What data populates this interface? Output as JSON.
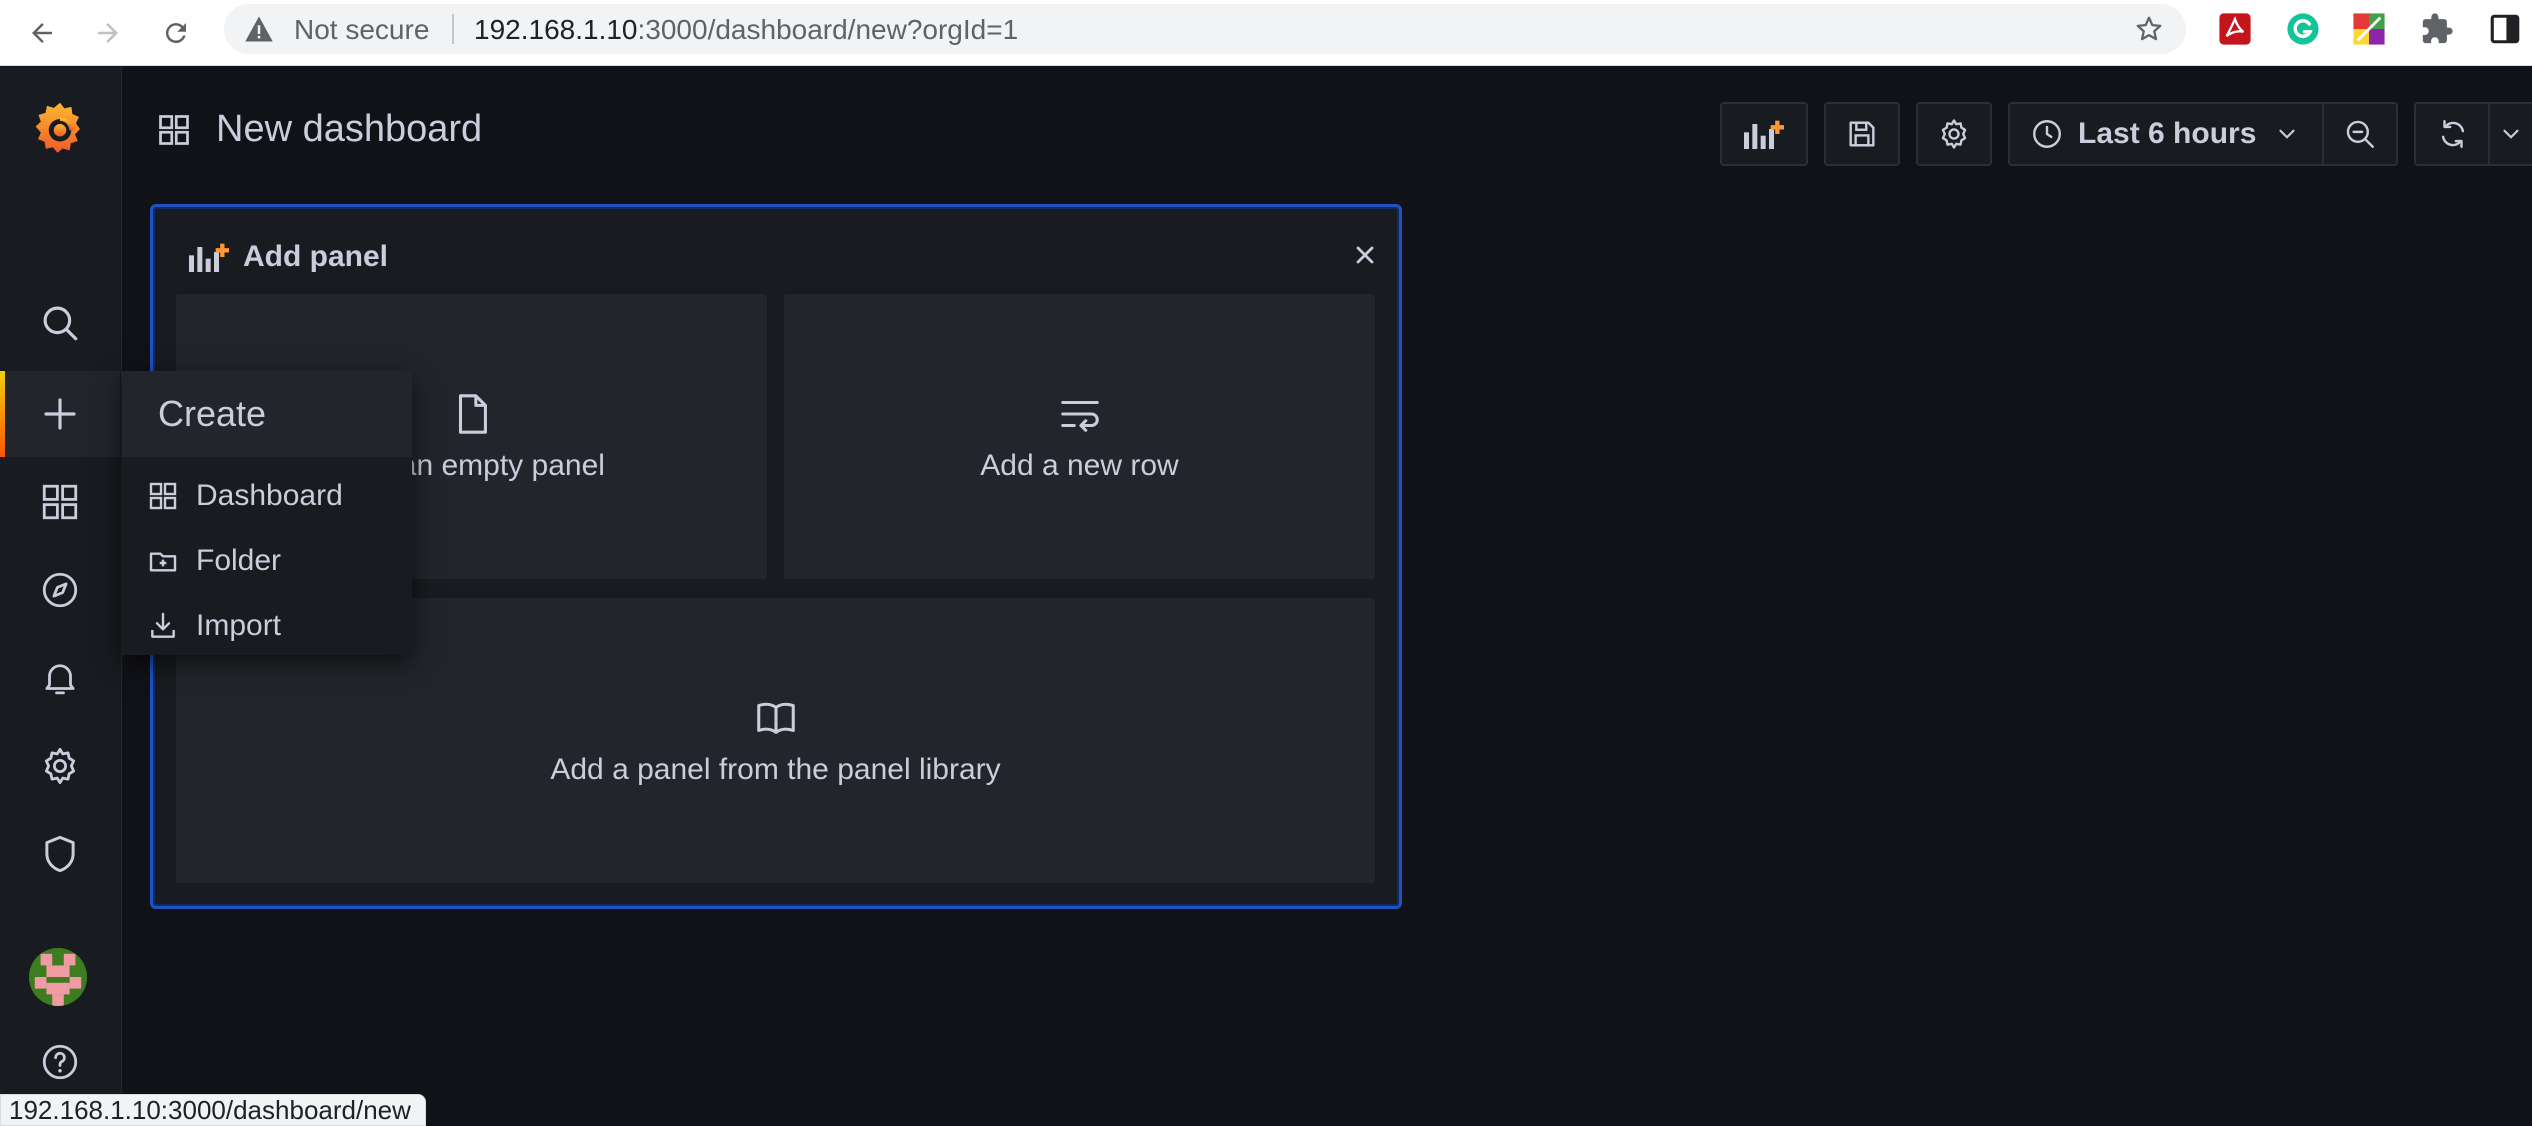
{
  "browser": {
    "security_label": "Not secure",
    "url_host": "192.168.1.10",
    "url_rest": ":3000/dashboard/new?orgId=1",
    "status_url": "192.168.1.10:3000/dashboard/new"
  },
  "sidebar": {
    "items": [
      "search-icon",
      "plus-icon",
      "dashboards-icon",
      "explore-icon",
      "alerting-icon",
      "settings-icon",
      "shield-icon",
      "help-icon"
    ],
    "active": "plus-icon"
  },
  "create_menu": {
    "title": "Create",
    "items": [
      {
        "label": "Dashboard",
        "icon": "apps-icon"
      },
      {
        "label": "Folder",
        "icon": "folder-plus-icon"
      },
      {
        "label": "Import",
        "icon": "import-icon"
      }
    ]
  },
  "topnav": {
    "title": "New dashboard",
    "time_range": "Last 6 hours"
  },
  "add_panel": {
    "title": "Add panel",
    "cards": [
      {
        "label": "Add an empty panel",
        "icon": "file-blank-icon"
      },
      {
        "label": "Add a new row",
        "icon": "wrap-text-icon"
      },
      {
        "label": "Add a panel from the panel library",
        "icon": "book-open-icon"
      }
    ]
  },
  "colors": {
    "background": "#111217",
    "sidebar": "#181b1f",
    "card": "#22252b",
    "panel_border": "#1f52c2",
    "accent_orange": "#ff780a"
  }
}
